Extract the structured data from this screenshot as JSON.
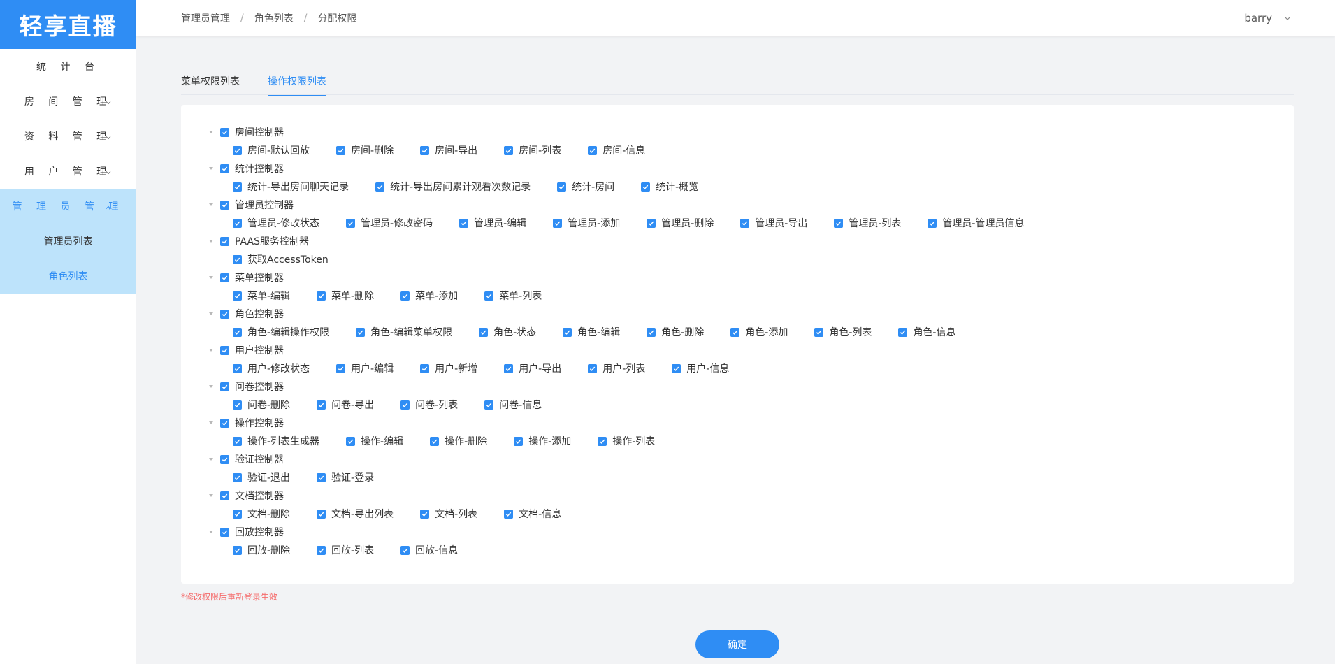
{
  "app": {
    "logo": "轻享直播"
  },
  "sidebar": {
    "items": [
      {
        "label": "统 计 台",
        "has_chevron": false
      },
      {
        "label": "房 间 管 理",
        "has_chevron": true
      },
      {
        "label": "资 料 管 理",
        "has_chevron": true
      },
      {
        "label": "用 户 管 理",
        "has_chevron": true
      },
      {
        "label": "管 理 员 管 理",
        "has_chevron": true,
        "expanded": true
      }
    ],
    "submenu": [
      {
        "label": "管理员列表",
        "active": false
      },
      {
        "label": "角色列表",
        "active": true
      }
    ]
  },
  "header": {
    "breadcrumb": [
      "管理员管理",
      "角色列表",
      "分配权限"
    ],
    "user": "barry"
  },
  "tabs": [
    {
      "label": "菜单权限列表",
      "active": false
    },
    {
      "label": "操作权限列表",
      "active": true
    }
  ],
  "tree": [
    {
      "label": "房间控制器",
      "children": [
        "房间-默认回放",
        "房间-删除",
        "房间-导出",
        "房间-列表",
        "房间-信息"
      ]
    },
    {
      "label": "统计控制器",
      "children": [
        "统计-导出房间聊天记录",
        "统计-导出房间累计观看次数记录",
        "统计-房间",
        "统计-概览"
      ]
    },
    {
      "label": "管理员控制器",
      "children": [
        "管理员-修改状态",
        "管理员-修改密码",
        "管理员-编辑",
        "管理员-添加",
        "管理员-删除",
        "管理员-导出",
        "管理员-列表",
        "管理员-管理员信息"
      ]
    },
    {
      "label": "PAAS服务控制器",
      "children": [
        "获取AccessToken"
      ]
    },
    {
      "label": "菜单控制器",
      "children": [
        "菜单-编辑",
        "菜单-删除",
        "菜单-添加",
        "菜单-列表"
      ]
    },
    {
      "label": "角色控制器",
      "children": [
        "角色-编辑操作权限",
        "角色-编辑菜单权限",
        "角色-状态",
        "角色-编辑",
        "角色-删除",
        "角色-添加",
        "角色-列表",
        "角色-信息"
      ]
    },
    {
      "label": "用户控制器",
      "children": [
        "用户-修改状态",
        "用户-编辑",
        "用户-新增",
        "用户-导出",
        "用户-列表",
        "用户-信息"
      ]
    },
    {
      "label": "问卷控制器",
      "children": [
        "问卷-删除",
        "问卷-导出",
        "问卷-列表",
        "问卷-信息"
      ]
    },
    {
      "label": "操作控制器",
      "children": [
        "操作-列表生成器",
        "操作-编辑",
        "操作-删除",
        "操作-添加",
        "操作-列表"
      ]
    },
    {
      "label": "验证控制器",
      "children": [
        "验证-退出",
        "验证-登录"
      ]
    },
    {
      "label": "文档控制器",
      "children": [
        "文档-删除",
        "文档-导出列表",
        "文档-列表",
        "文档-信息"
      ]
    },
    {
      "label": "回放控制器",
      "children": [
        "回放-删除",
        "回放-列表",
        "回放-信息"
      ]
    }
  ],
  "note": "*修改权限后重新登录生效",
  "confirm_label": "确定",
  "colors": {
    "accent": "#2f8df4",
    "submenu_bg": "#bde3fb",
    "warning": "#f56c6c"
  }
}
